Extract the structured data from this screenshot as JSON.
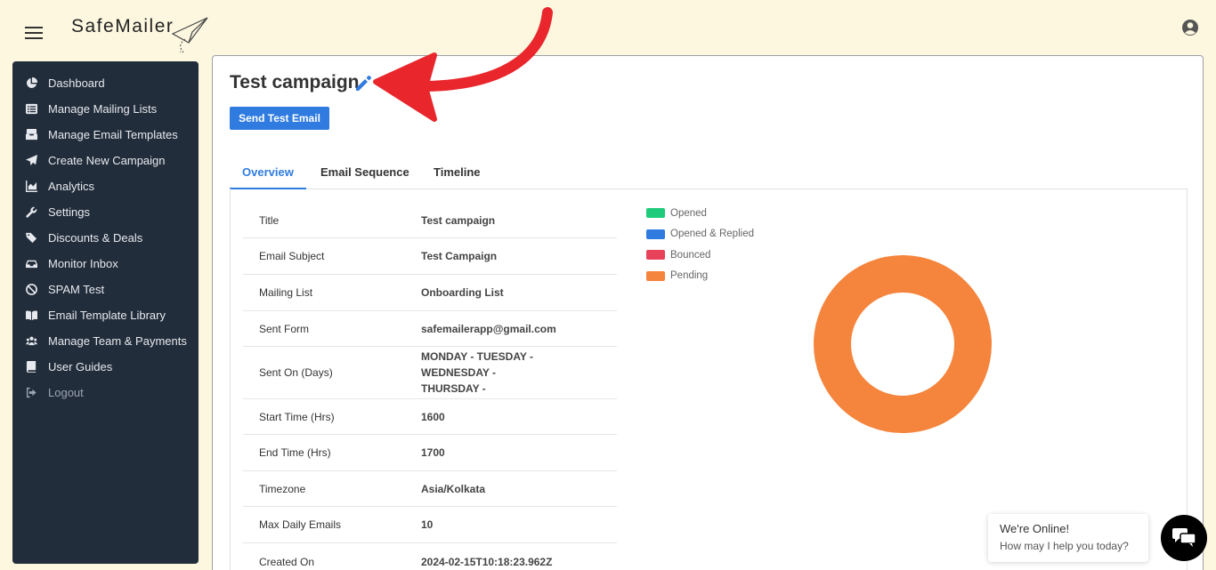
{
  "app": {
    "logo_text": "SafeMailer"
  },
  "sidebar": {
    "items": [
      {
        "label": "Dashboard",
        "icon": "pie-chart-icon"
      },
      {
        "label": "Manage Mailing Lists",
        "icon": "list-icon"
      },
      {
        "label": "Manage Email Templates",
        "icon": "inbox-icon"
      },
      {
        "label": "Create New Campaign",
        "icon": "paper-plane-icon"
      },
      {
        "label": "Analytics",
        "icon": "area-chart-icon"
      },
      {
        "label": "Settings",
        "icon": "wrench-icon"
      },
      {
        "label": "Discounts & Deals",
        "icon": "tags-icon"
      },
      {
        "label": "Monitor Inbox",
        "icon": "tray-icon"
      },
      {
        "label": "SPAM Test",
        "icon": "ban-icon"
      },
      {
        "label": "Email Template Library",
        "icon": "book-icon"
      },
      {
        "label": "Manage Team & Payments",
        "icon": "users-icon"
      },
      {
        "label": "User Guides",
        "icon": "guide-book-icon"
      },
      {
        "label": "Logout",
        "icon": "logout-icon"
      }
    ]
  },
  "page": {
    "title": "Test campaign",
    "send_test_label": "Send Test Email"
  },
  "tabs": [
    {
      "label": "Overview",
      "active": true
    },
    {
      "label": "Email Sequence",
      "active": false
    },
    {
      "label": "Timeline",
      "active": false
    }
  ],
  "overview": {
    "rows": [
      {
        "label": "Title",
        "value": "Test campaign"
      },
      {
        "label": "Email Subject",
        "value": "Test Campaign"
      },
      {
        "label": "Mailing List",
        "value": "Onboarding List"
      },
      {
        "label": "Sent Form",
        "value": "safemailerapp@gmail.com"
      },
      {
        "label": "Sent On (Days)",
        "value": "MONDAY - TUESDAY - WEDNESDAY - THURSDAY -"
      },
      {
        "label": "Start Time (Hrs)",
        "value": "1600"
      },
      {
        "label": "End Time (Hrs)",
        "value": "1700"
      },
      {
        "label": "Timezone",
        "value": "Asia/Kolkata"
      },
      {
        "label": "Max Daily Emails",
        "value": "10"
      },
      {
        "label": "Created On",
        "value": "2024-02-15T10:18:23.962Z"
      }
    ]
  },
  "chart_data": {
    "type": "pie",
    "variant": "doughnut",
    "categories": [
      "Opened",
      "Opened & Replied",
      "Bounced",
      "Pending"
    ],
    "values": [
      0,
      0,
      0,
      1
    ],
    "colors": [
      "#1ecb7b",
      "#2f7be0",
      "#e8425a",
      "#f5843c"
    ],
    "legend_position": "top-left"
  },
  "chat": {
    "title": "We're Online!",
    "subtitle": "How may I help you today?"
  }
}
